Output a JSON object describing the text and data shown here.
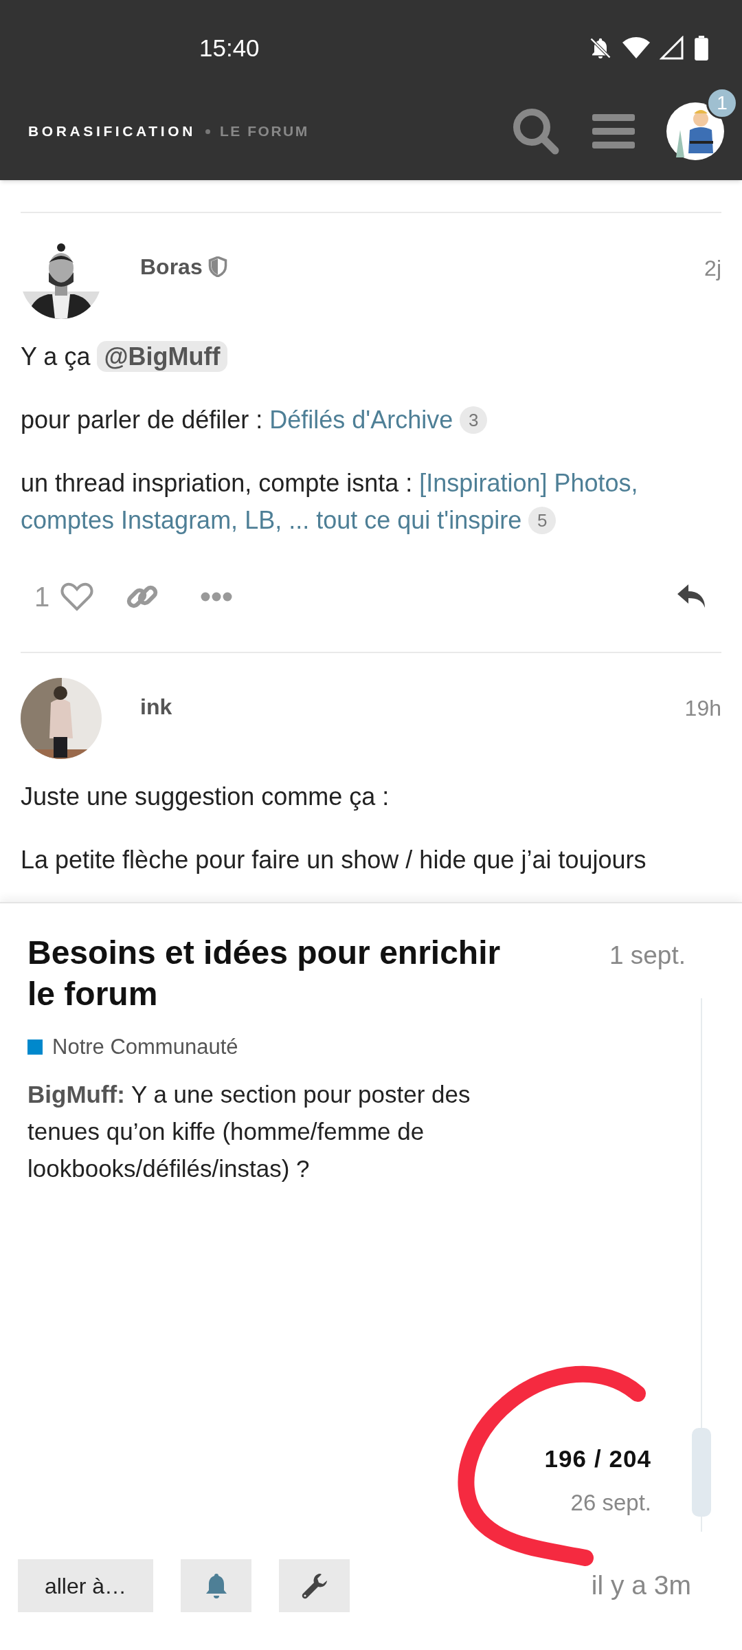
{
  "status_bar": {
    "time": "15:40"
  },
  "header": {
    "site_title": "BORASIFICATION",
    "site_subtitle": "LE FORUM",
    "notification_count": "1"
  },
  "posts": [
    {
      "author": "Boras",
      "moderator": true,
      "time": "2j",
      "paragraphs": [
        [
          {
            "kind": "text",
            "text": "Y a ça"
          },
          {
            "kind": "mention",
            "text": "@BigMuff"
          }
        ],
        [
          {
            "kind": "text",
            "text": "pour parler de défiler :"
          },
          {
            "kind": "link",
            "text": "Défilés d'Archive"
          },
          {
            "kind": "count",
            "text": "3"
          }
        ],
        [
          {
            "kind": "text",
            "text": "un thread inspriation, compte isnta :"
          },
          {
            "kind": "link",
            "lines": [
              "[Inspiration] Photos,",
              "comptes Instagram, LB, ... tout ce qui t'inspire"
            ]
          },
          {
            "kind": "count",
            "text": "5"
          }
        ]
      ],
      "likes": "1"
    },
    {
      "author": "ink",
      "moderator": false,
      "time": "19h",
      "paragraphs": [
        [
          {
            "kind": "text",
            "text": "Juste une suggestion comme ça :"
          }
        ],
        [
          {
            "kind": "text",
            "text": "La petite flèche pour faire un show / hide que j’ai toujours"
          }
        ]
      ]
    }
  ],
  "topic": {
    "title": "Besoins et idées pour enrichir le forum",
    "date": "1 sept.",
    "category": {
      "name": "Notre Communauté",
      "color": "#0088cc"
    },
    "excerpt": {
      "author": "BigMuff:",
      "text": "Y a une section pour poster des tenues qu’on kiffe (homme/femme de lookbooks/défilés/instas) ?"
    }
  },
  "timeline": {
    "position": "196 / 204",
    "date": "26 sept.",
    "last_activity": "il y a 3m"
  },
  "footer_buttons": [
    {
      "kind": "text",
      "label": "aller à…"
    },
    {
      "kind": "bell"
    },
    {
      "kind": "wrench"
    }
  ]
}
